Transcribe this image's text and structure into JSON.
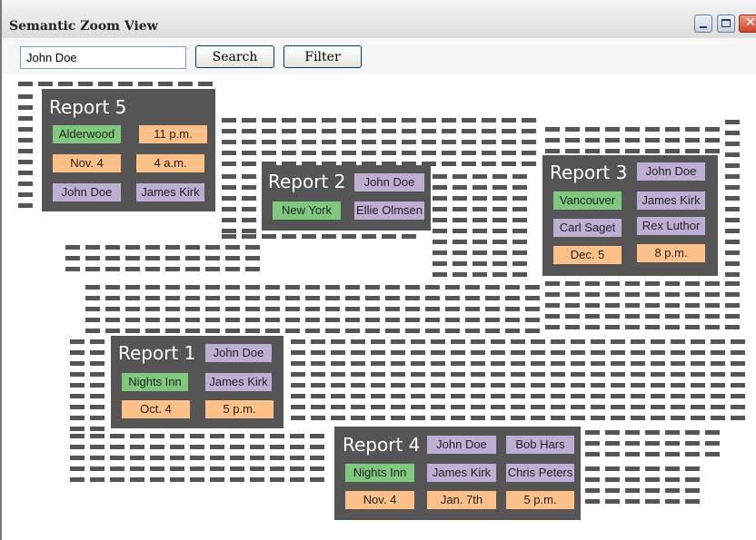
{
  "window": {
    "title": "Semantic Zoom View",
    "controls": {
      "close_glyph": "✕"
    }
  },
  "toolbar": {
    "search_value": "John Doe",
    "search_label": "Search",
    "filter_label": "Filter"
  },
  "reports": {
    "r5": {
      "title": "Report 5",
      "location": "Alderwood",
      "time1": "11 p.m.",
      "date": "Nov. 4",
      "time2": "4 a.m.",
      "person1": "John Doe",
      "person2": "James Kirk"
    },
    "r2": {
      "title": "Report 2",
      "person1": "John Doe",
      "location": "New York",
      "person2": "Ellie Olmsen"
    },
    "r3": {
      "title": "Report 3",
      "person1": "John Doe",
      "location": "Vancouver",
      "person2": "James Kirk",
      "person3": "Carl Saget",
      "person4": "Rex Luthor",
      "date": "Dec. 5",
      "time": "8 p.m."
    },
    "r1": {
      "title": "Report 1",
      "person1": "John Doe",
      "location": "Nights Inn",
      "person2": "James Kirk",
      "date": "Oct. 4",
      "time": "5 p.m."
    },
    "r4": {
      "title": "Report 4",
      "person1": "John Doe",
      "person2": "Bob Hars",
      "location": "Nights Inn",
      "person3": "James Kirk",
      "person4": "Chris Peters",
      "date1": "Nov. 4",
      "date2": "Jan. 7th",
      "time": "5 p.m."
    }
  },
  "colors": {
    "location": "#7fc97f",
    "time_date": "#fdc086",
    "person": "#beaed4",
    "report_bg": "#555555",
    "document_marks": "#555555"
  }
}
